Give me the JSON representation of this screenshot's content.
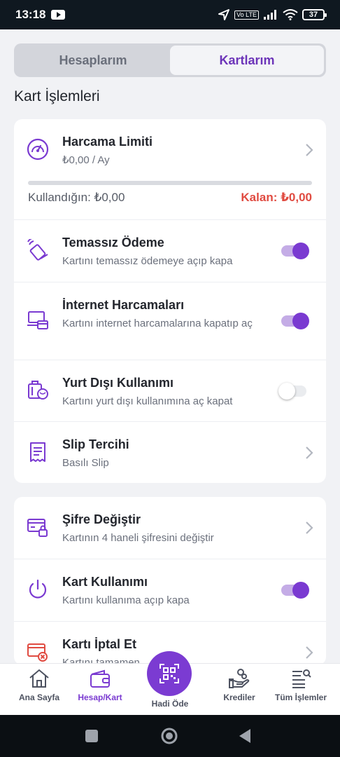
{
  "status_bar": {
    "time": "13:18",
    "volte": "Vo LTE",
    "battery": "37"
  },
  "tabs": [
    {
      "label": "Hesaplarım",
      "active": false
    },
    {
      "label": "Kartlarım",
      "active": true
    }
  ],
  "section_title": "Kart İşlemleri",
  "spending_limit": {
    "title": "Harcama Limiti",
    "value": "₺0,00 / Ay",
    "used_label": "Kullandığın: ₺0,00",
    "remaining_label": "Kalan: ₺0,00",
    "progress": 0
  },
  "card_settings": [
    {
      "title": "Temassız Ödeme",
      "subtitle": "Kartını temassız ödemeye açıp kapa",
      "control": "toggle",
      "on": true,
      "icon": "contactless-icon"
    },
    {
      "title": "İnternet Harcamaları",
      "subtitle": "Kartını internet harcamalarına kapatıp aç",
      "control": "toggle",
      "on": true,
      "icon": "online-shopping-icon"
    },
    {
      "title": "Yurt Dışı Kullanımı",
      "subtitle": "Kartını yurt dışı kullanımına aç kapat",
      "control": "toggle",
      "on": false,
      "icon": "travel-icon"
    },
    {
      "title": "Slip Tercihi",
      "subtitle": "Basılı Slip",
      "control": "chevron",
      "icon": "receipt-icon"
    }
  ],
  "card_security": [
    {
      "title": "Şifre Değiştir",
      "subtitle": "Kartının 4 haneli şifresini değiştir",
      "control": "chevron",
      "icon": "card-lock-icon"
    },
    {
      "title": "Kart Kullanımı",
      "subtitle": "Kartını kullanıma açıp kapa",
      "control": "toggle",
      "on": true,
      "icon": "power-icon"
    },
    {
      "title": "Kartı İptal Et",
      "subtitle": "Kartını tamamen",
      "control": "chevron",
      "icon": "card-cancel-icon"
    }
  ],
  "bottom_nav": {
    "items": [
      {
        "label": "Ana Sayfa",
        "icon": "home-icon",
        "active": false
      },
      {
        "label": "Hesap/Kart",
        "icon": "wallet-icon",
        "active": true
      },
      {
        "label": "Hadi Öde",
        "icon": "qr-code-icon",
        "active": false
      },
      {
        "label": "Krediler",
        "icon": "loan-icon",
        "active": false
      },
      {
        "label": "Tüm İşlemler",
        "icon": "all-transactions-icon",
        "active": false
      }
    ]
  },
  "colors": {
    "accent": "#7a3ad1",
    "danger": "#e04b41",
    "background": "#f1f2f5"
  }
}
